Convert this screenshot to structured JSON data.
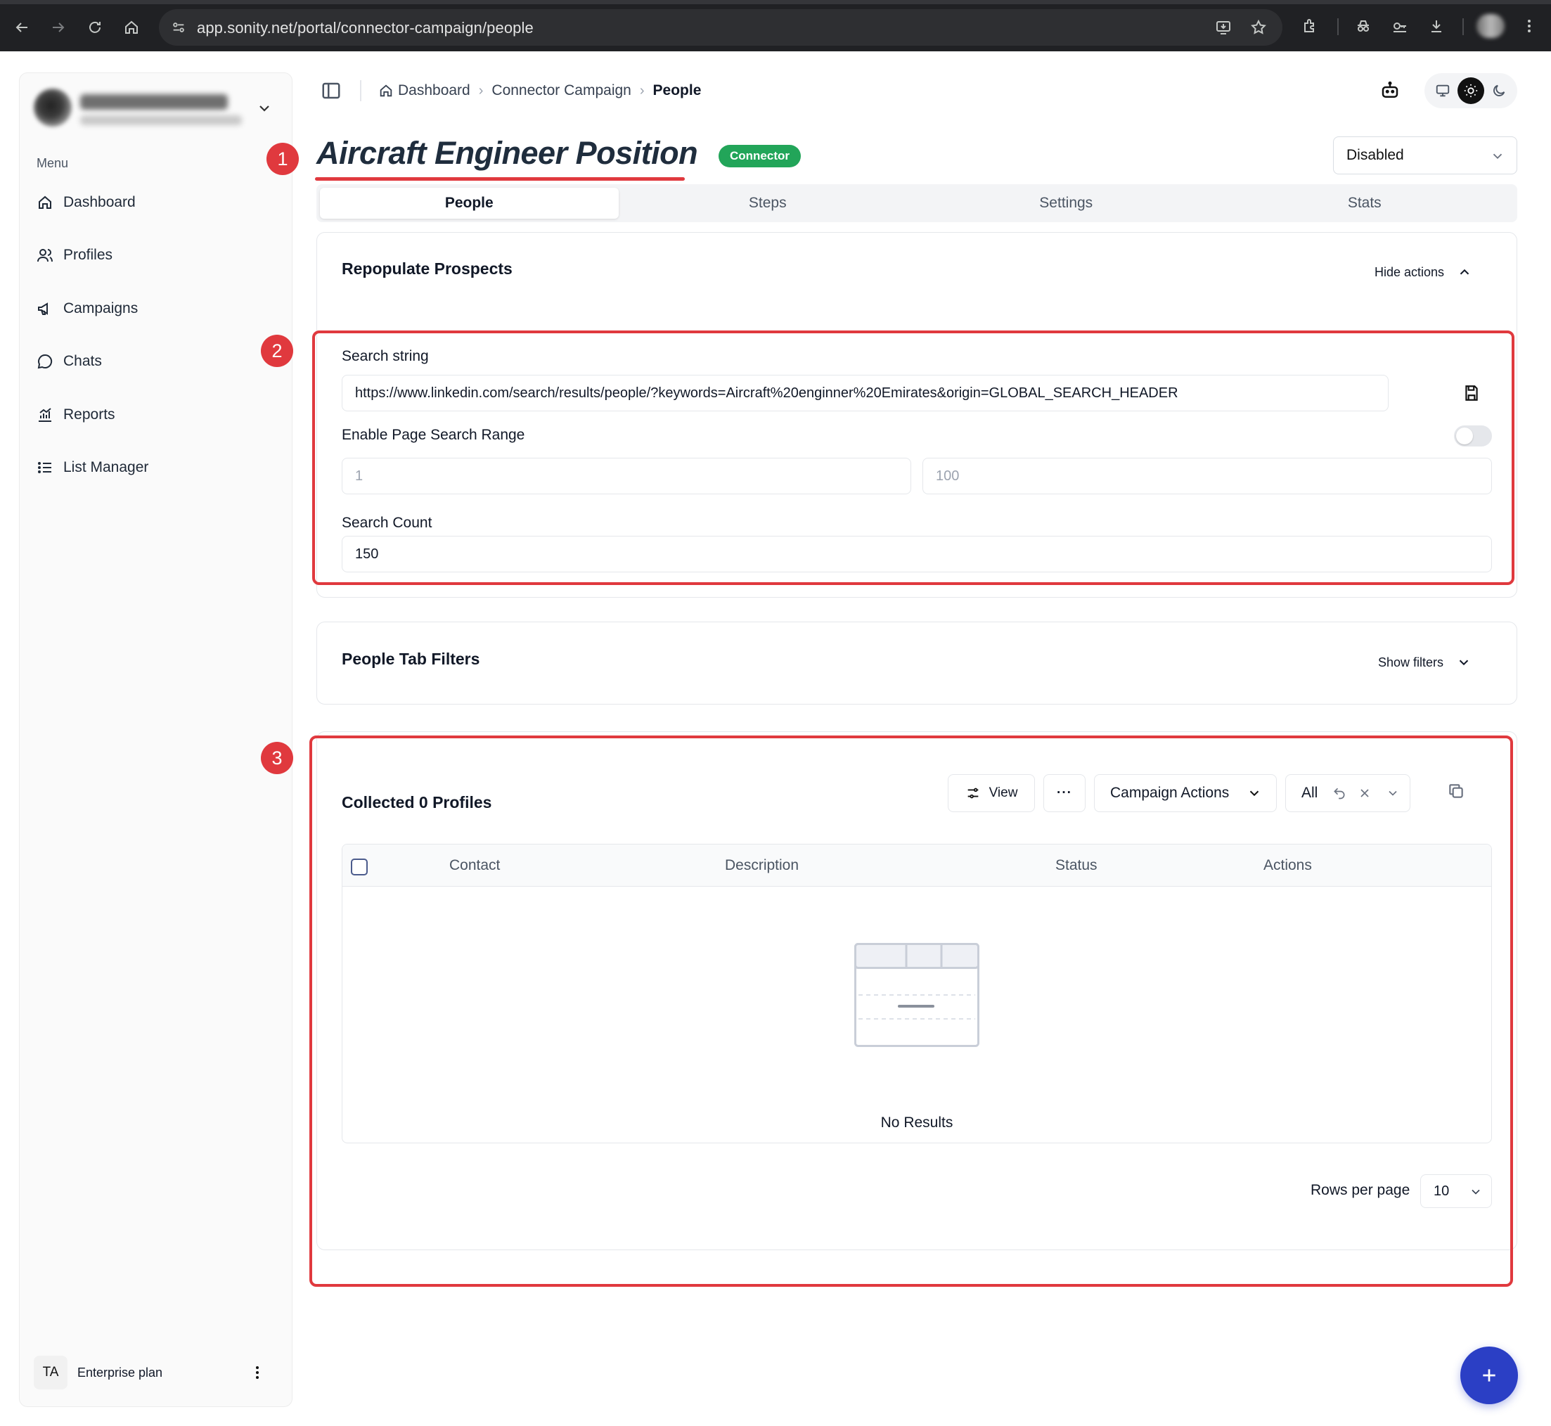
{
  "browser": {
    "url": "app.sonity.net/portal/connector-campaign/people"
  },
  "sidebar": {
    "menu_label": "Menu",
    "items": [
      {
        "label": "Dashboard",
        "icon": "home-icon"
      },
      {
        "label": "Profiles",
        "icon": "users-icon"
      },
      {
        "label": "Campaigns",
        "icon": "megaphone-icon"
      },
      {
        "label": "Chats",
        "icon": "chat-icon"
      },
      {
        "label": "Reports",
        "icon": "chart-icon"
      },
      {
        "label": "List Manager",
        "icon": "list-icon"
      }
    ],
    "footer": {
      "initials": "TA",
      "plan": "Enterprise plan"
    }
  },
  "breadcrumb": {
    "items": [
      "Dashboard",
      "Connector Campaign",
      "People"
    ]
  },
  "header": {
    "title": "Aircraft Engineer Position",
    "badge": "Connector",
    "status": "Disabled"
  },
  "tabs": [
    "People",
    "Steps",
    "Settings",
    "Stats"
  ],
  "repopulate": {
    "title": "Repopulate Prospects",
    "toggle_label": "Hide actions",
    "search_string_label": "Search string",
    "search_string_value": "https://www.linkedin.com/search/results/people/?keywords=Aircraft%20enginner%20Emirates&origin=GLOBAL_SEARCH_HEADER",
    "page_range_label": "Enable Page Search Range",
    "page_range_enabled": false,
    "range_from_placeholder": "1",
    "range_to_placeholder": "100",
    "search_count_label": "Search Count",
    "search_count_value": "150"
  },
  "filters": {
    "title": "People Tab Filters",
    "toggle_label": "Show filters"
  },
  "collected": {
    "title": "Collected 0 Profiles",
    "view_label": "View",
    "more_label": "···",
    "campaign_actions_label": "Campaign Actions",
    "filter_value": "All",
    "columns": [
      "Contact",
      "Description",
      "Status",
      "Actions"
    ],
    "empty_text": "No Results",
    "rows_per_page_label": "Rows per page",
    "rows_per_page_value": "10"
  },
  "annotations": [
    "1",
    "2",
    "3"
  ],
  "colors": {
    "annotation": "#e0393e",
    "badge": "#22a559",
    "fab": "#2b3fc5"
  }
}
